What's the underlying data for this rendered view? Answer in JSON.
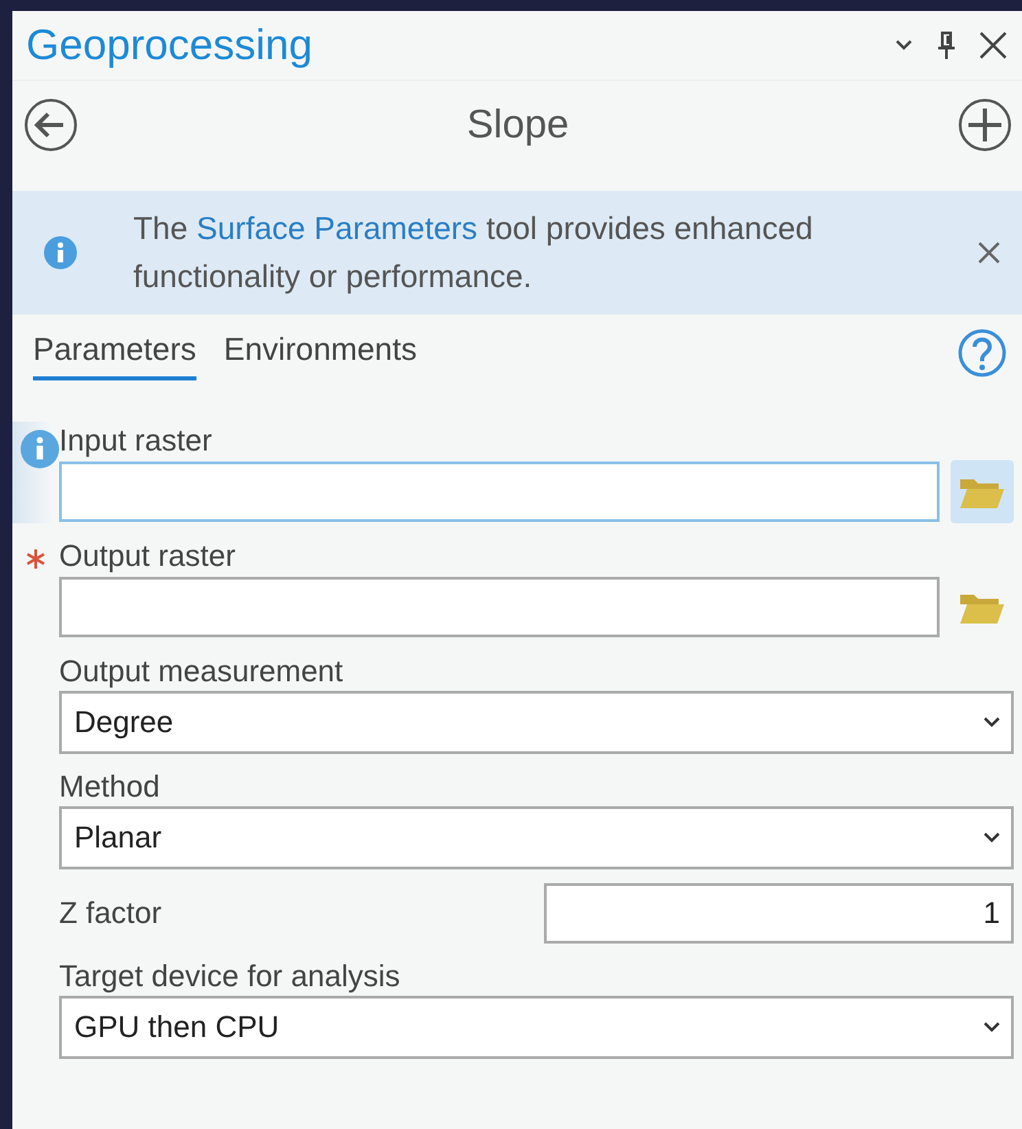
{
  "window": {
    "title": "Geoprocessing"
  },
  "tool": {
    "title": "Slope"
  },
  "banner": {
    "before": "The ",
    "link": "Surface Parameters",
    "after": " tool provides enhanced functionality or performance."
  },
  "tabs": [
    {
      "label": "Parameters",
      "selected": true
    },
    {
      "label": "Environments",
      "selected": false
    }
  ],
  "parameters": [
    {
      "kind": "file",
      "label": "Input raster",
      "info": true,
      "required": false,
      "focused": true
    },
    {
      "kind": "file",
      "label": "Output raster",
      "info": false,
      "required": true,
      "focused": false
    },
    {
      "kind": "dropdown",
      "label": "Output measurement",
      "value": "Degree"
    },
    {
      "kind": "dropdown",
      "label": "Method",
      "value": "Planar"
    },
    {
      "kind": "number",
      "label": "Z factor",
      "value": "1"
    },
    {
      "kind": "dropdown",
      "label": "Target device for analysis",
      "value": "GPU then CPU"
    }
  ]
}
